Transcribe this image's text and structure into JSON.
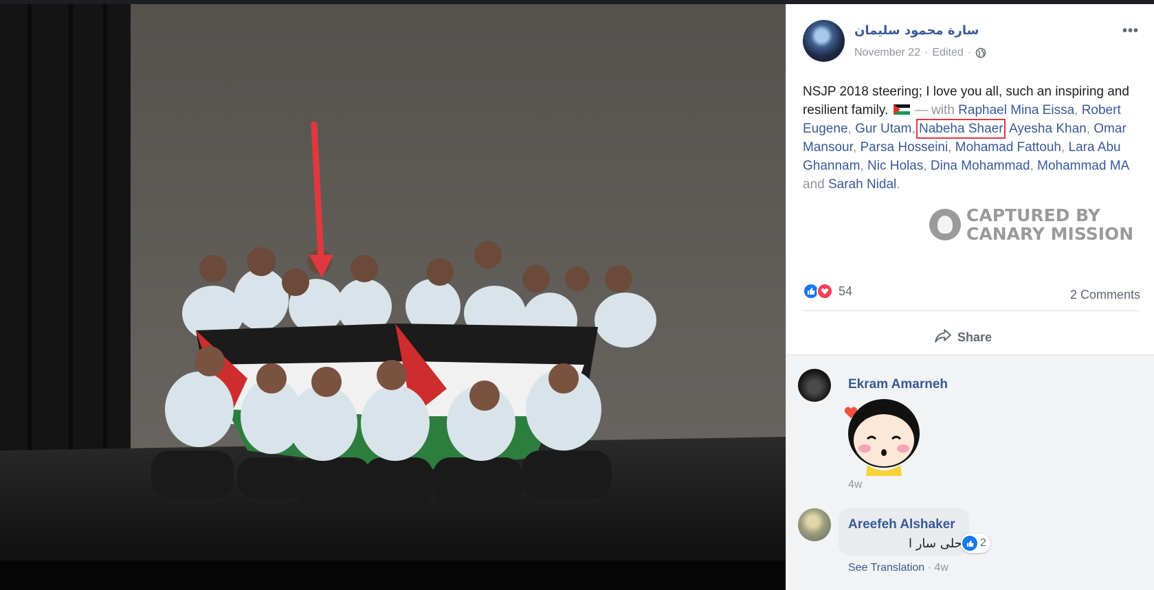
{
  "post": {
    "author": "سارة محمود سليمان",
    "date": "November 22",
    "separator": " · ",
    "edited": "Edited",
    "more_label": "•••",
    "text_before": "NSJP 2018 steering; I love you all, such an inspiring and resilient family.",
    "with_label": "— with",
    "tags": [
      "Raphael Mina Eissa",
      "Robert Eugene",
      "Gur Utam",
      "Nabeha Shaer",
      "Ayesha Khan",
      "Omar Mansour",
      "Parsa Hosseini",
      "Mohamad Fattouh",
      "Lara Abu Ghannam",
      "Nic Holas",
      "Dina Mohammad",
      "Mohammad MA"
    ],
    "and_label": "and",
    "last_tag": "Sarah Nidal",
    "period": ".",
    "comma": ","
  },
  "watermark": {
    "line1": "CAPTURED BY",
    "line2": "CANARY MISSION"
  },
  "reactions": {
    "count": "54",
    "comments_label": "2 Comments"
  },
  "share_label": "Share",
  "comments": [
    {
      "name": "Ekram Amarneh",
      "time": "4w",
      "sticker": "sticker-cartoon-face"
    },
    {
      "name": "Areefeh Alshaker",
      "text": "احلى سار ا",
      "likes": "2",
      "see_translation": "See Translation",
      "time": "4w"
    }
  ],
  "colors": {
    "link": "#385898",
    "muted": "#90949c",
    "highlight": "#e0383e",
    "arrow": "#e0383e",
    "like": "#1877f2",
    "love": "#f33e58"
  },
  "icons": [
    "globe-icon",
    "flag-icon",
    "more-icon",
    "share-icon",
    "like-icon",
    "love-icon"
  ]
}
